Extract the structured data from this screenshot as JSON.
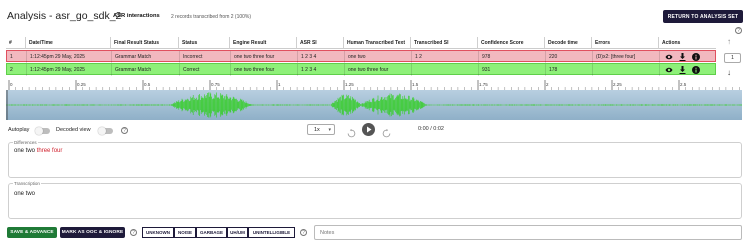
{
  "header": {
    "title": "Analysis - asr_go_sdk_2",
    "subtitle": "ASR interactions",
    "records": "2 records transcribed from 2 (100%)",
    "return_button": "RETURN TO ANALYSIS SET"
  },
  "table": {
    "columns": [
      "#",
      "Date/Time",
      "Final Result Status",
      "Status",
      "Engine Result",
      "ASR SI",
      "Human Transcribed Text",
      "Transcribed SI",
      "Confidence Score",
      "Decode time",
      "Errors",
      "Actions"
    ],
    "rows": [
      {
        "num": "1",
        "datetime": "1:12:45pm 29 May, 2025",
        "final_status": "Grammar Match",
        "status": "Incorrect",
        "engine_result": "one two three four",
        "asr_si": "1 2 3 4",
        "human_text": "one two",
        "transcribed_si": "1 2",
        "confidence": "978",
        "decode_time": "220",
        "errors": "(D)x2: [three four]",
        "highlight": "#f2b8bf"
      },
      {
        "num": "2",
        "datetime": "1:12:45pm 29 May, 2025",
        "final_status": "Grammar Match",
        "status": "Correct",
        "engine_result": "one two three four",
        "asr_si": "1 2 3 4",
        "human_text": "one two three four",
        "transcribed_si": "",
        "confidence": "931",
        "decode_time": "178",
        "errors": "",
        "highlight": "#8ef079"
      }
    ],
    "row_icons": [
      "eye-icon",
      "download-icon",
      "info-icon"
    ]
  },
  "side": {
    "current": "1",
    "up_icon": "arrow-up-icon",
    "down_icon": "arrow-down-icon"
  },
  "timeline": {
    "ticks": [
      "0",
      "0.25",
      "0.5",
      "0.75",
      "1",
      "1.25",
      "1.5",
      "1.75",
      "2",
      "2.25",
      "2.5"
    ]
  },
  "player": {
    "autoplay_label": "Autoplay",
    "decoded_label": "Decoded view",
    "speed": "1x",
    "time": "0:00 / 0:02"
  },
  "differences": {
    "label": "Differences",
    "matched": "one two",
    "deleted": "three four"
  },
  "transcription": {
    "label": "Transcription",
    "value": "one two"
  },
  "bottom": {
    "save_button": "SAVE & ADVANCE",
    "ooc_button": "MARK AS OOC & IGNORE",
    "tags": [
      "UNKNOWN",
      "NOISE",
      "GARBAGE",
      "UH/UM",
      "UNINTELLIGIBLE"
    ],
    "notes_placeholder": "Notes"
  },
  "colors": {
    "accent_dark": "#1e1a3a",
    "accent_green": "#1f7a36",
    "error_red": "#d0202c",
    "waveform": "#2fcf1f"
  }
}
